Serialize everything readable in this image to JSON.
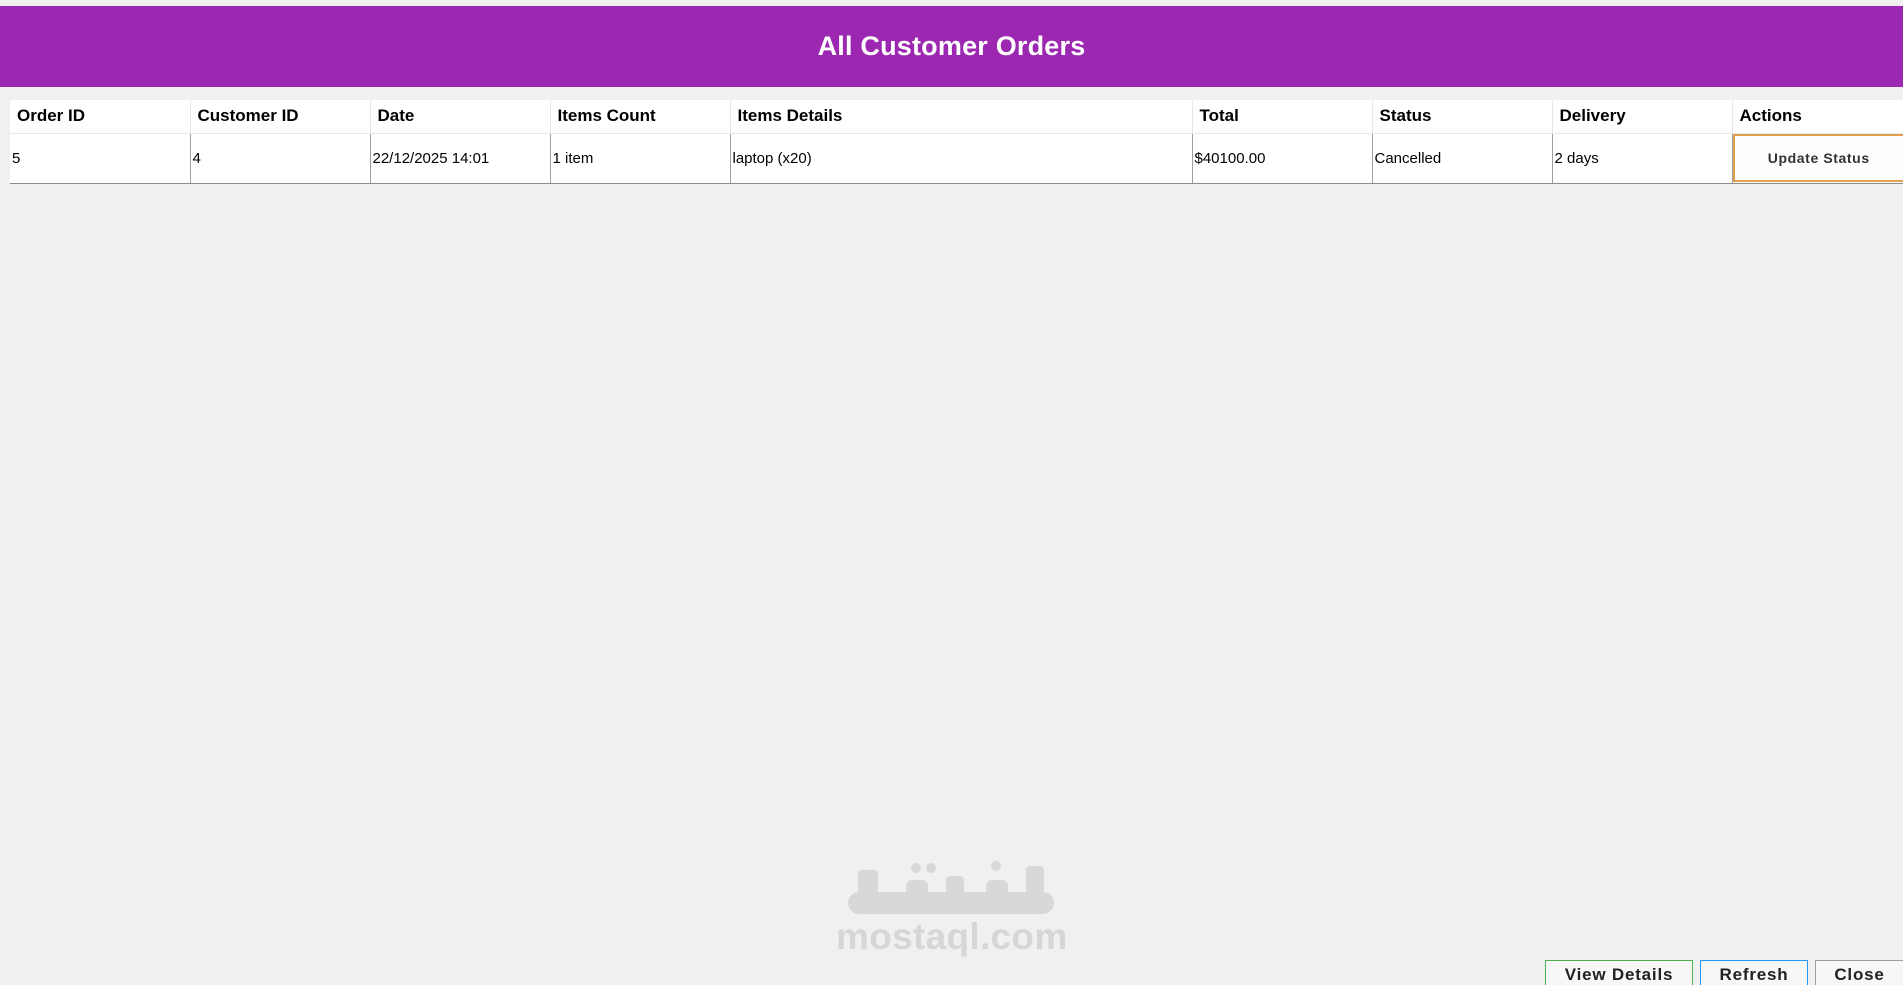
{
  "header": {
    "title": "All Customer Orders"
  },
  "table": {
    "columns": [
      "Order ID",
      "Customer ID",
      "Date",
      "Items Count",
      "Items Details",
      "Total",
      "Status",
      "Delivery",
      "Actions"
    ],
    "rows": [
      {
        "order_id": "5",
        "customer_id": "4",
        "date": "22/12/2025 14:01",
        "items_count": "1 item",
        "items_details": "laptop (x20)",
        "total": "$40100.00",
        "status": "Cancelled",
        "delivery": "2 days",
        "action_label": "Update Status"
      }
    ]
  },
  "footer": {
    "view_details_label": "View Details",
    "refresh_label": "Refresh",
    "close_label": "Close"
  },
  "watermark": {
    "text": "mostaql.com"
  },
  "colors": {
    "header_bg": "#9c27b0",
    "view_details_border": "#4caf50",
    "refresh_border": "#2196f3",
    "update_status_border": "#e0a050"
  }
}
